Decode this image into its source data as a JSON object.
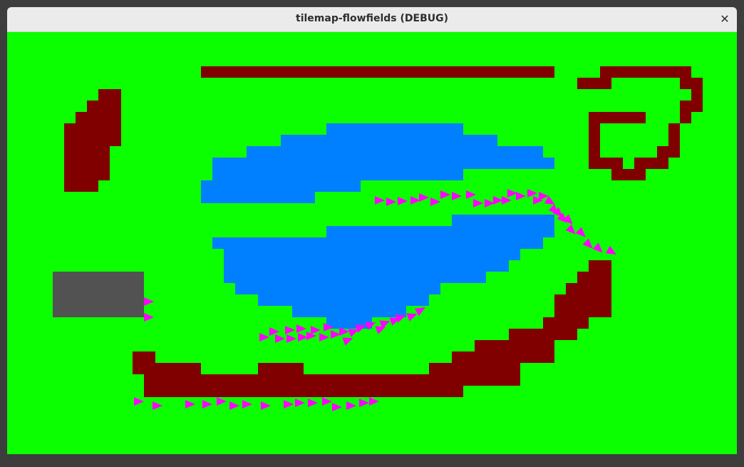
{
  "window": {
    "title": "tilemap-flowfields (DEBUG)",
    "close_glyph": "✕"
  },
  "colors": {
    "grass": "#0cff00",
    "wall": "#800000",
    "water": "#0080ff",
    "spawn": "#525252",
    "flow_arrow": "#ff00ff"
  }
}
